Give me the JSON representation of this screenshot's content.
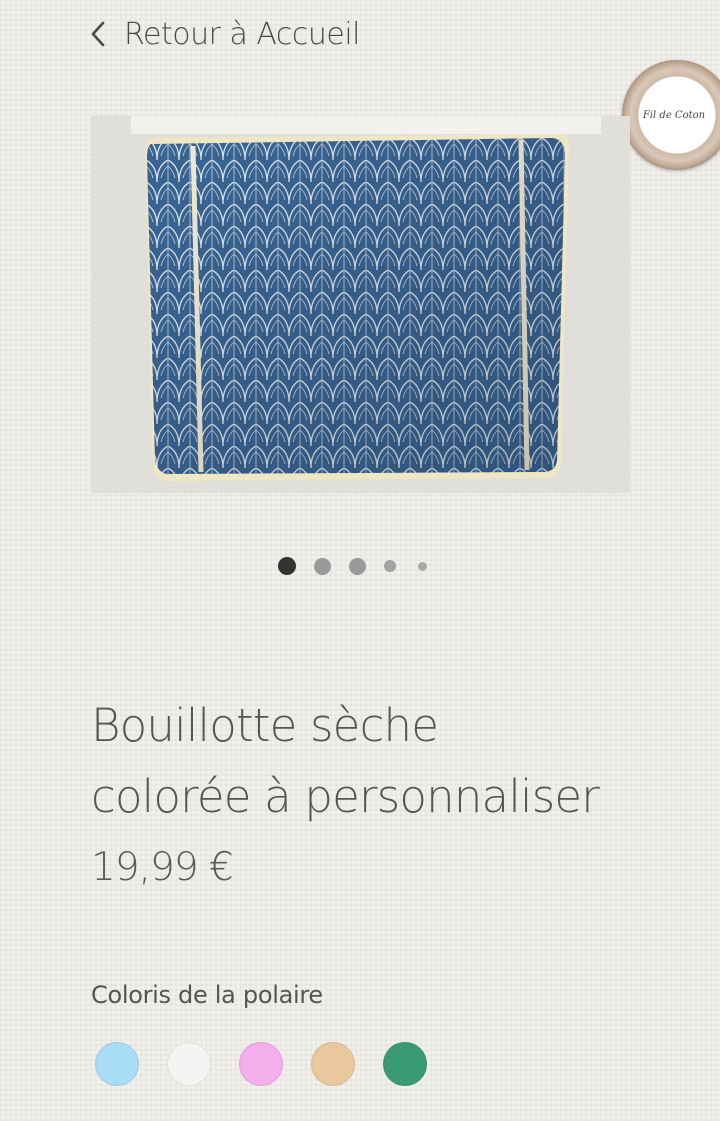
{
  "nav": {
    "back_label": "Retour à Accueil",
    "back_icon": "chevron-left-icon"
  },
  "brand": {
    "logo_text": "Fil de Coton"
  },
  "gallery": {
    "image_description": "blue-fabric-pillow-product-photo",
    "slide_count": 5,
    "active_slide": 1
  },
  "product": {
    "title_line1": "Bouillotte sèche",
    "title_line2": "colorée à personnaliser",
    "price": "19,99 €"
  },
  "options": {
    "colors_label": "Coloris de la polaire",
    "swatches": [
      {
        "name": "light-blue",
        "color": "#a9dcf6"
      },
      {
        "name": "white",
        "color": "#f4f4f2"
      },
      {
        "name": "pink",
        "color": "#f4aeec"
      },
      {
        "name": "beige",
        "color": "#eac89e"
      },
      {
        "name": "green",
        "color": "#3a9a76"
      }
    ]
  }
}
